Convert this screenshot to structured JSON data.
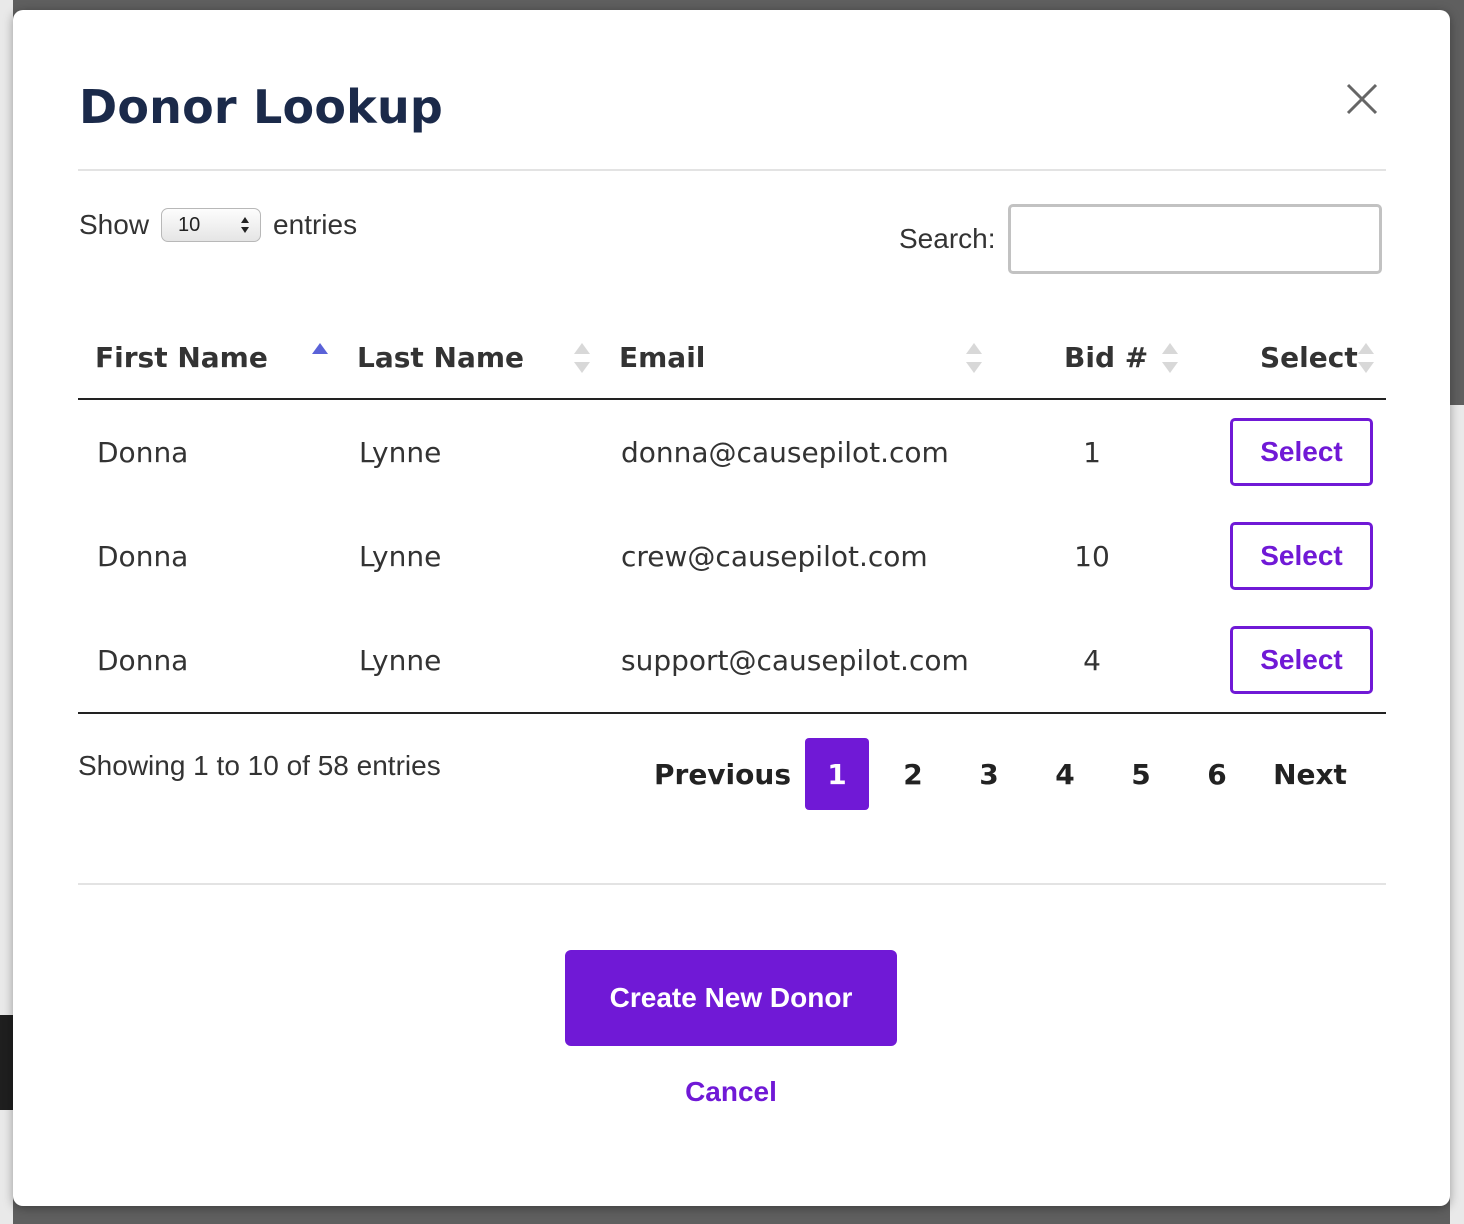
{
  "modal": {
    "title": "Donor Lookup",
    "close_icon": "close-icon"
  },
  "length_menu": {
    "prefix": "Show",
    "value": "10",
    "suffix": "entries"
  },
  "search": {
    "label": "Search:",
    "value": "",
    "placeholder": ""
  },
  "table": {
    "columns": [
      {
        "label": "First Name",
        "sort": "ascending"
      },
      {
        "label": "Last Name",
        "sort": "none"
      },
      {
        "label": "Email",
        "sort": "none"
      },
      {
        "label": "Bid #",
        "sort": "none"
      },
      {
        "label": "Select",
        "sort": "none"
      }
    ],
    "rows": [
      {
        "first": "Donna",
        "last": "Lynne",
        "email": "donna@causepilot.com",
        "bid": "1",
        "action": "Select"
      },
      {
        "first": "Donna",
        "last": "Lynne",
        "email": "crew@causepilot.com",
        "bid": "10",
        "action": "Select"
      },
      {
        "first": "Donna",
        "last": "Lynne",
        "email": "support@causepilot.com",
        "bid": "4",
        "action": "Select"
      }
    ]
  },
  "info": "Showing 1 to 10 of 58 entries",
  "pagination": {
    "previous": "Previous",
    "pages": [
      "1",
      "2",
      "3",
      "4",
      "5",
      "6"
    ],
    "current": "1",
    "next": "Next"
  },
  "actions": {
    "create": "Create New Donor",
    "cancel": "Cancel"
  },
  "colors": {
    "accent": "#7019d6",
    "title": "#1b2a4a",
    "sort_active": "#5a62d8",
    "sort_inactive": "#d8d8d8"
  }
}
